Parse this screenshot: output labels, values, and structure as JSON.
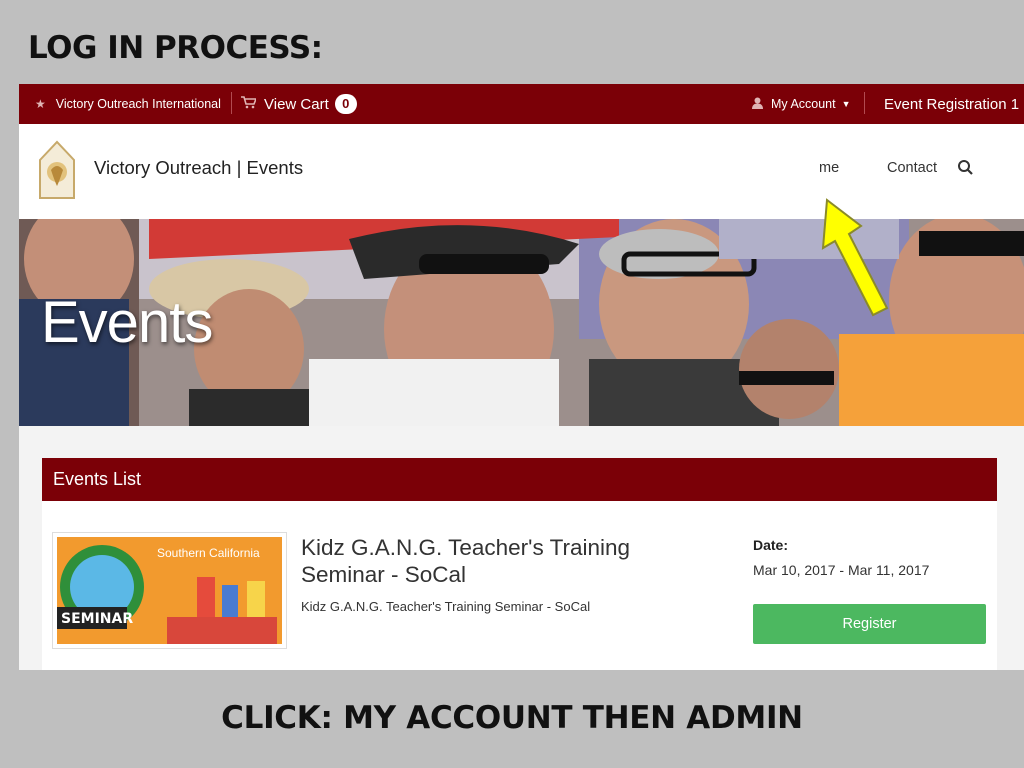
{
  "slide": {
    "title": "LOG IN PROCESS:",
    "caption": "CLICK: MY ACCOUNT THEN ADMIN"
  },
  "topbar": {
    "org_label": "Victory Outreach International",
    "org_icon": "star-icon",
    "cart_label": "View Cart",
    "cart_icon": "cart-icon",
    "cart_count": "0",
    "account_label": "My Account",
    "account_icon": "user-icon",
    "event_registration": "Event Registration 1"
  },
  "header": {
    "brand": "Victory Outreach | Events",
    "nav": [
      "me",
      "Contact"
    ],
    "search_icon": "search-icon"
  },
  "hero": {
    "title": "Events"
  },
  "events_list": {
    "heading": "Events List",
    "items": [
      {
        "title": "Kidz G.A.N.G. Teacher's Training Seminar - SoCal",
        "subtitle": "Kidz G.A.N.G. Teacher's Training Seminar - SoCal",
        "date_label": "Date:",
        "date_value": "Mar 10, 2017 - Mar 11, 2017",
        "register_label": "Register",
        "image_text_top": "Southern California",
        "image_text_bottom": "SEMINAR"
      }
    ]
  },
  "colors": {
    "brand_red": "#7b0007",
    "register_green": "#4cb860",
    "arrow_yellow": "#ffff00"
  }
}
